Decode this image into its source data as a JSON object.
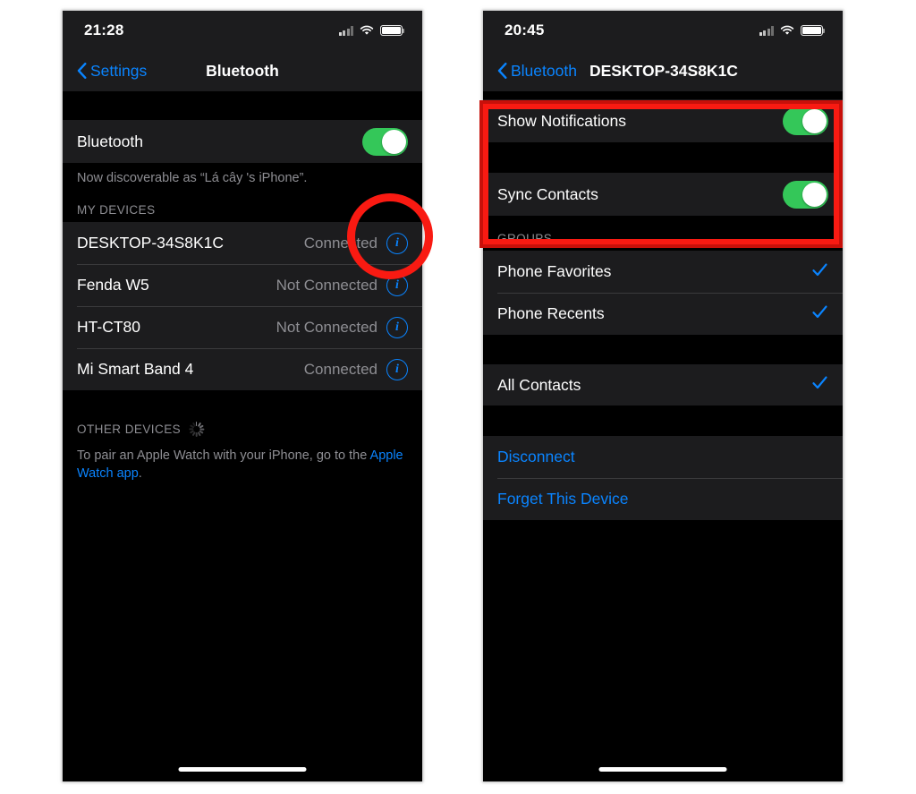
{
  "left_phone": {
    "status_bar": {
      "time": "21:28",
      "icons": [
        "cellular-signal-icon",
        "wifi-icon",
        "battery-icon"
      ]
    },
    "nav": {
      "back_label": "Settings",
      "title": "Bluetooth",
      "back_icon": "chevron-left-icon"
    },
    "bluetooth_row": {
      "label": "Bluetooth",
      "toggle_state": "on"
    },
    "discoverable_note": "Now discoverable as “Lá cây 's iPhone”.",
    "my_devices_header": "MY DEVICES",
    "devices": [
      {
        "name": "DESKTOP-34S8K1C",
        "status": "Connected",
        "info_icon": "info-icon"
      },
      {
        "name": "Fenda W5",
        "status": "Not Connected",
        "info_icon": "info-icon"
      },
      {
        "name": "HT-CT80",
        "status": "Not Connected",
        "info_icon": "info-icon"
      },
      {
        "name": "Mi Smart Band 4",
        "status": "Connected",
        "info_icon": "info-icon"
      }
    ],
    "other_devices_header": "OTHER DEVICES",
    "other_devices_note_prefix": "To pair an Apple Watch with your iPhone, go to the ",
    "other_devices_note_link": "Apple Watch app",
    "other_devices_note_suffix": "."
  },
  "right_phone": {
    "status_bar": {
      "time": "20:45",
      "icons": [
        "cellular-signal-icon",
        "wifi-icon",
        "battery-icon"
      ]
    },
    "nav": {
      "back_label": "Bluetooth",
      "title": "DESKTOP-34S8K1C",
      "back_icon": "chevron-left-icon"
    },
    "show_notifications": {
      "label": "Show Notifications",
      "toggle_state": "on"
    },
    "sync_contacts": {
      "label": "Sync Contacts",
      "toggle_state": "on"
    },
    "groups_header": "GROUPS",
    "groups": [
      {
        "label": "Phone Favorites",
        "checked": true
      },
      {
        "label": "Phone Recents",
        "checked": true
      }
    ],
    "all_contacts": {
      "label": "All Contacts",
      "checked": true
    },
    "disconnect_label": "Disconnect",
    "forget_label": "Forget This Device"
  },
  "annotations": {
    "circle_target": "info-button-desktop-34s8k1c",
    "box_target": "show-notifications-and-sync-contacts-rows",
    "color": "#f91a12",
    "color_outer": "#c8100a"
  },
  "theme": {
    "background": "#000000",
    "cell_background": "#1c1c1e",
    "separator": "#3a3a3c",
    "accent_blue": "#0a84ff",
    "accent_green": "#34c759",
    "secondary_text": "#8e8e93"
  }
}
